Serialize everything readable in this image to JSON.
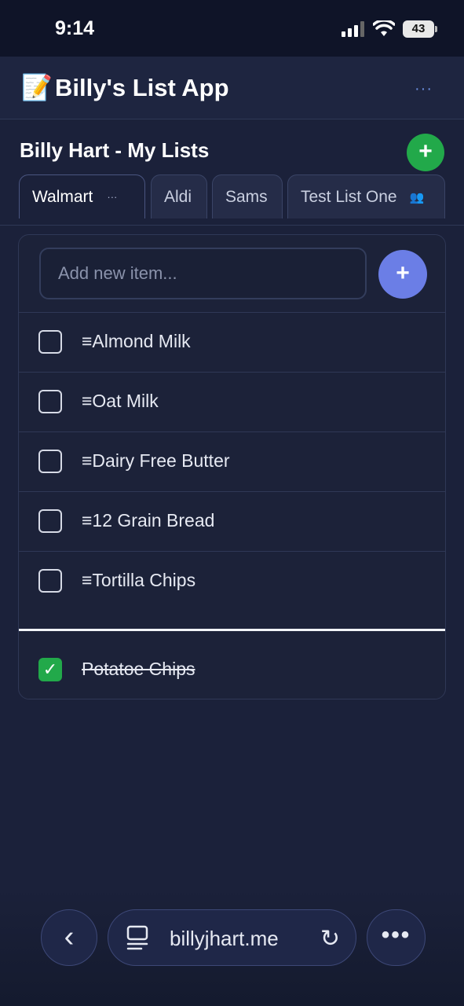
{
  "status": {
    "time": "9:14",
    "battery": "43"
  },
  "header": {
    "emoji": "📝",
    "title": "Billy's List App",
    "menu": "···"
  },
  "lists_title": "Billy Hart - My Lists",
  "add_list_label": "+",
  "tabs": [
    {
      "label": "Walmart",
      "extra": "···",
      "active": true
    },
    {
      "label": "Aldi"
    },
    {
      "label": "Sams"
    },
    {
      "label": "Test List One",
      "extra": "👥"
    }
  ],
  "new_item": {
    "placeholder": "Add new item...",
    "button": "+"
  },
  "items": [
    {
      "label": "≡Almond Milk",
      "checked": false
    },
    {
      "label": "≡Oat Milk",
      "checked": false
    },
    {
      "label": "≡Dairy Free Butter",
      "checked": false
    },
    {
      "label": "≡12 Grain Bread",
      "checked": false
    },
    {
      "label": "≡Tortilla Chips",
      "checked": false
    }
  ],
  "completed": [
    {
      "label": "Potatoe Chips",
      "checked": true,
      "check_glyph": "✓"
    }
  ],
  "browser": {
    "back": "‹",
    "url": "billyjhart.me",
    "reload": "↻",
    "more": "•••"
  },
  "colors": {
    "background": "#1b213a",
    "accent_green": "#22a94a",
    "accent_blue": "#6b7ee6"
  }
}
